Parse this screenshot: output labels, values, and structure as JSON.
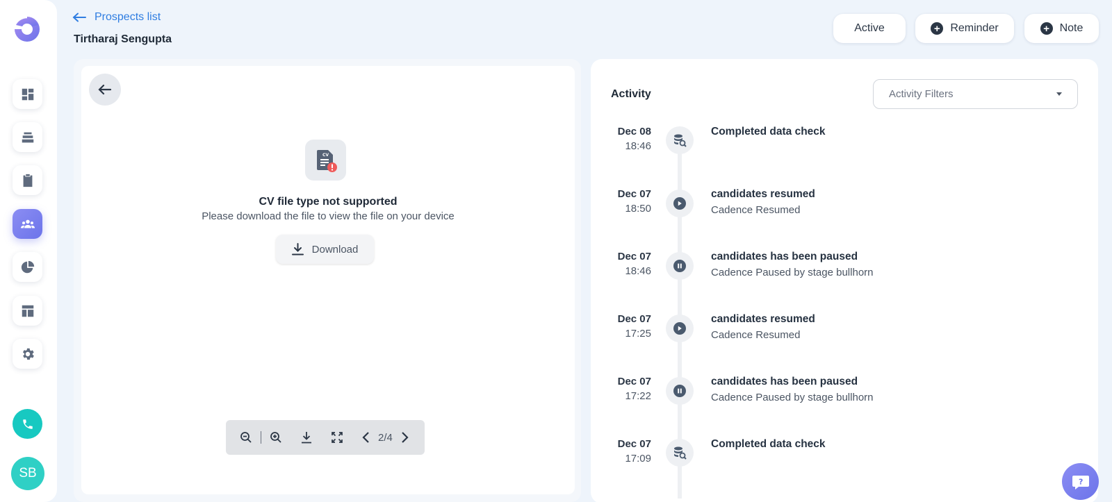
{
  "header": {
    "back_label": "Prospects list",
    "prospect_name": "Tirtharaj Sengupta",
    "status_label": "Active",
    "reminder_label": "Reminder",
    "note_label": "Note"
  },
  "sidebar": {
    "avatar_initials": "SB",
    "items": [
      {
        "icon": "dashboard-icon"
      },
      {
        "icon": "layers-icon"
      },
      {
        "icon": "clipboard-icon"
      },
      {
        "icon": "people-icon",
        "active": true
      },
      {
        "icon": "pie-chart-icon"
      },
      {
        "icon": "layout-icon"
      },
      {
        "icon": "gear-icon"
      }
    ]
  },
  "cv_viewer": {
    "error_title": "CV file type not supported",
    "error_message": "Please download the file to view the file on your device",
    "download_label": "Download",
    "page_indicator": "2/4"
  },
  "activity": {
    "title": "Activity",
    "filter_placeholder": "Activity Filters",
    "items": [
      {
        "date": "Dec 08",
        "time": "18:46",
        "title": "Completed data check",
        "subtitle": "",
        "icon": "data-check-icon"
      },
      {
        "date": "Dec 07",
        "time": "18:50",
        "title": "candidates resumed",
        "subtitle": "Cadence Resumed",
        "icon": "play-icon"
      },
      {
        "date": "Dec 07",
        "time": "18:46",
        "title": "candidates has been paused",
        "subtitle": "Cadence Paused by stage bullhorn",
        "icon": "pause-icon"
      },
      {
        "date": "Dec 07",
        "time": "17:25",
        "title": "candidates resumed",
        "subtitle": "Cadence Resumed",
        "icon": "play-icon"
      },
      {
        "date": "Dec 07",
        "time": "17:22",
        "title": "candidates has been paused",
        "subtitle": "Cadence Paused by stage bullhorn",
        "icon": "pause-icon"
      },
      {
        "date": "Dec 07",
        "time": "17:09",
        "title": "Completed data check",
        "subtitle": "",
        "icon": "data-check-icon"
      }
    ]
  },
  "colors": {
    "accent": "#6c74ea",
    "link": "#2f7de1",
    "phone": "#17c9c1",
    "background": "#eef4fb"
  }
}
